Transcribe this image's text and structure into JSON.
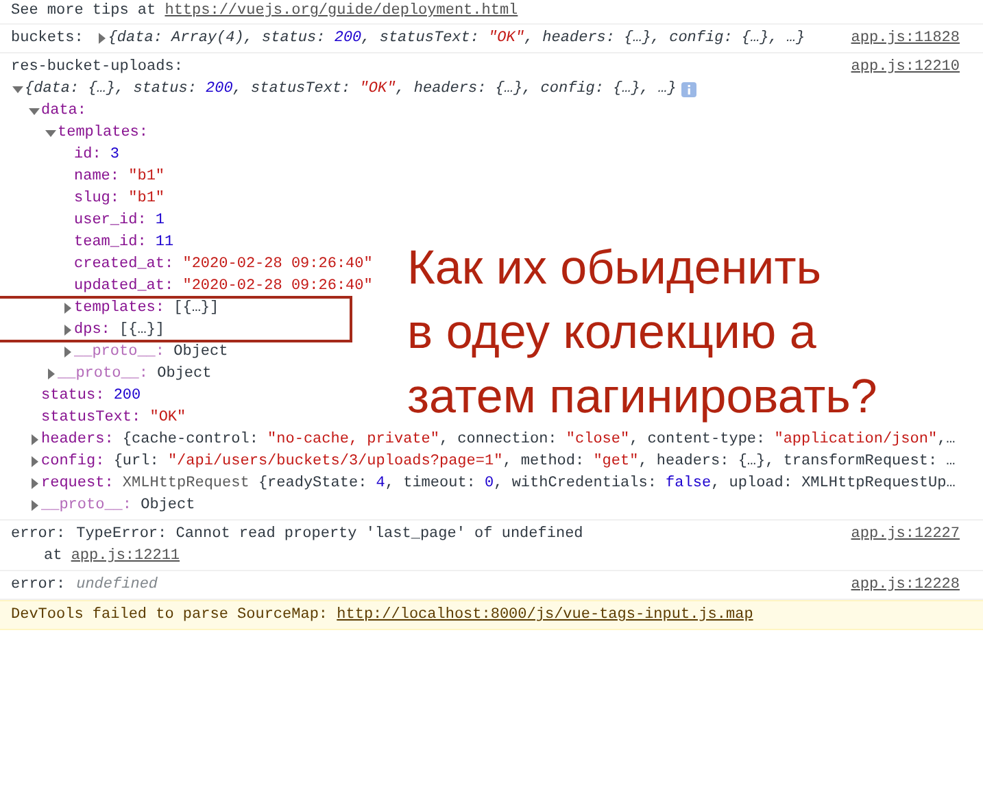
{
  "console": [
    {
      "kind": "info",
      "text": "See more tips at ",
      "link": "https://vuejs.org/guide/deployment.html"
    },
    {
      "kind": "log",
      "label": "buckets:",
      "expanded": false,
      "source": "app.js:11828",
      "preview": [
        {
          "text": "{data: Array(4), status: ",
          "kind": "plain"
        },
        {
          "text": "200",
          "kind": "number"
        },
        {
          "text": ", statusText: ",
          "kind": "plain"
        },
        {
          "text": "\"OK\"",
          "kind": "string"
        },
        {
          "text": ", headers: {…}, config: {…}, …}",
          "kind": "plain"
        }
      ]
    },
    {
      "kind": "log",
      "label": "res-bucket-uploads:",
      "expanded": true,
      "source": "app.js:12210",
      "preview": [
        {
          "text": "{data: {…}, status: ",
          "kind": "plain"
        },
        {
          "text": "200",
          "kind": "number"
        },
        {
          "text": ", statusText: ",
          "kind": "plain"
        },
        {
          "text": "\"OK\"",
          "kind": "string"
        },
        {
          "text": ", headers: {…}, config: {…}, …}",
          "kind": "plain"
        }
      ],
      "children": [
        {
          "key": "data:",
          "expanded": true,
          "children": [
            {
              "key": "templates:",
              "expanded": true,
              "children": [
                {
                  "key": "id:",
                  "value": [
                    {
                      "text": "3",
                      "kind": "number"
                    }
                  ]
                },
                {
                  "key": "name:",
                  "value": [
                    {
                      "text": "\"b1\"",
                      "kind": "string"
                    }
                  ]
                },
                {
                  "key": "slug:",
                  "value": [
                    {
                      "text": "\"b1\"",
                      "kind": "string"
                    }
                  ]
                },
                {
                  "key": "user_id:",
                  "value": [
                    {
                      "text": "1",
                      "kind": "number"
                    }
                  ]
                },
                {
                  "key": "team_id:",
                  "value": [
                    {
                      "text": "11",
                      "kind": "number"
                    }
                  ]
                },
                {
                  "key": "created_at:",
                  "value": [
                    {
                      "text": "\"2020-02-28 09:26:40\"",
                      "kind": "string"
                    }
                  ]
                },
                {
                  "key": "updated_at:",
                  "value": [
                    {
                      "text": "\"2020-02-28 09:26:40\"",
                      "kind": "string"
                    }
                  ]
                },
                {
                  "key": "templates:",
                  "expanded": false,
                  "boxed": true,
                  "value": [
                    {
                      "text": "[{…}]",
                      "kind": "plain"
                    }
                  ]
                },
                {
                  "key": "dps:",
                  "expanded": false,
                  "boxed": true,
                  "value": [
                    {
                      "text": "[{…}]",
                      "kind": "plain"
                    }
                  ]
                },
                {
                  "key": "__proto__:",
                  "expanded": false,
                  "dim": true,
                  "value": [
                    {
                      "text": "Object",
                      "kind": "plain"
                    }
                  ]
                }
              ]
            },
            {
              "key": "__proto__:",
              "expanded": false,
              "dim": true,
              "value": [
                {
                  "text": "Object",
                  "kind": "plain"
                }
              ]
            }
          ]
        },
        {
          "key": "status:",
          "value": [
            {
              "text": "200",
              "kind": "number"
            }
          ]
        },
        {
          "key": "statusText:",
          "value": [
            {
              "text": "\"OK\"",
              "kind": "string"
            }
          ]
        },
        {
          "key": "headers:",
          "expanded": false,
          "value": [
            {
              "text": "{cache-control: ",
              "kind": "plain"
            },
            {
              "text": "\"no-cache, private\"",
              "kind": "string"
            },
            {
              "text": ", connection: ",
              "kind": "plain"
            },
            {
              "text": "\"close\"",
              "kind": "string"
            },
            {
              "text": ", content-type: ",
              "kind": "plain"
            },
            {
              "text": "\"application/json\"",
              "kind": "string"
            },
            {
              "text": ",…",
              "kind": "plain"
            }
          ]
        },
        {
          "key": "config:",
          "expanded": false,
          "value": [
            {
              "text": "{url: ",
              "kind": "plain"
            },
            {
              "text": "\"/api/users/buckets/3/uploads?page=1\"",
              "kind": "string"
            },
            {
              "text": ", method: ",
              "kind": "plain"
            },
            {
              "text": "\"get\"",
              "kind": "string"
            },
            {
              "text": ", headers: {…}, transformRequest: …",
              "kind": "plain"
            }
          ]
        },
        {
          "key": "request:",
          "expanded": false,
          "value": [
            {
              "text": "XMLHttpRequest ",
              "kind": "class"
            },
            {
              "text": "{readyState: ",
              "kind": "plain"
            },
            {
              "text": "4",
              "kind": "number"
            },
            {
              "text": ", timeout: ",
              "kind": "plain"
            },
            {
              "text": "0",
              "kind": "number"
            },
            {
              "text": ", withCredentials: ",
              "kind": "plain"
            },
            {
              "text": "false",
              "kind": "number"
            },
            {
              "text": ", upload: XMLHttpRequestUp…",
              "kind": "plain"
            }
          ]
        },
        {
          "key": "__proto__:",
          "expanded": false,
          "dim": true,
          "value": [
            {
              "text": "Object",
              "kind": "plain"
            }
          ]
        }
      ]
    },
    {
      "kind": "error",
      "label": "error:",
      "text": "TypeError: Cannot read property 'last_page' of undefined",
      "stack_prefix": "at ",
      "stack_link": "app.js:12211",
      "source": "app.js:12227"
    },
    {
      "kind": "log",
      "label": "error:",
      "source": "app.js:12228",
      "preview": [
        {
          "text": "undefined",
          "kind": "undefined"
        }
      ]
    },
    {
      "kind": "warning",
      "text": "DevTools failed to parse SourceMap: ",
      "link": "http://localhost:8000/js/vue-tags-input.js.map"
    }
  ],
  "annotation": {
    "lines": [
      "Как их обьиденить",
      "в одеу колекцию а",
      "затем пагинировать?"
    ]
  }
}
